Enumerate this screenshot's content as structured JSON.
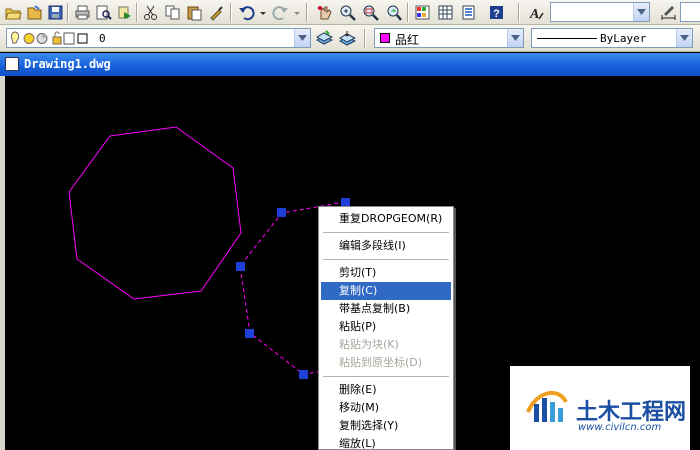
{
  "toolbar": {
    "icons": [
      "open-folder-icon",
      "save-icon",
      "print-icon",
      "print-preview-icon",
      "publish-icon",
      "cut-icon",
      "copy-icon",
      "paste-icon",
      "match-properties-icon",
      "undo-icon",
      "redo-icon",
      "pan-icon",
      "zoom-realtime-icon",
      "zoom-window-icon",
      "zoom-previous-icon",
      "properties-icon",
      "design-center-icon",
      "tool-palettes-icon",
      "help-icon",
      "text-style-icon",
      "dimension-style-icon"
    ],
    "font_combo_value": ""
  },
  "layers_bar": {
    "layer_value": "0",
    "color_value": "品红",
    "color_hex": "#ff00ff",
    "linetype_value": "ByLayer"
  },
  "window": {
    "title": "Drawing1.dwg"
  },
  "context_menu": {
    "items": [
      {
        "label": "重复DROPGEOM(R)",
        "state": "normal"
      },
      {
        "label": "编辑多段线(I)",
        "state": "normal"
      },
      {
        "label": "剪切(T)",
        "state": "normal"
      },
      {
        "label": "复制(C)",
        "state": "selected"
      },
      {
        "label": "带基点复制(B)",
        "state": "normal"
      },
      {
        "label": "粘贴(P)",
        "state": "normal"
      },
      {
        "label": "粘贴为块(K)",
        "state": "disabled"
      },
      {
        "label": "粘贴到原坐标(D)",
        "state": "disabled"
      },
      {
        "label": "删除(E)",
        "state": "normal"
      },
      {
        "label": "移动(M)",
        "state": "normal"
      },
      {
        "label": "复制选择(Y)",
        "state": "normal"
      },
      {
        "label": "缩放(L)",
        "state": "normal"
      }
    ]
  },
  "watermark": {
    "title": "土木工程网",
    "url": "www.civilcn.com"
  },
  "colors": {
    "canvas": "#000000",
    "polygon": "#ff00ff",
    "grip": "#1f3fd8",
    "menu_highlight": "#316ac5",
    "title_bar": "#1862dc"
  }
}
